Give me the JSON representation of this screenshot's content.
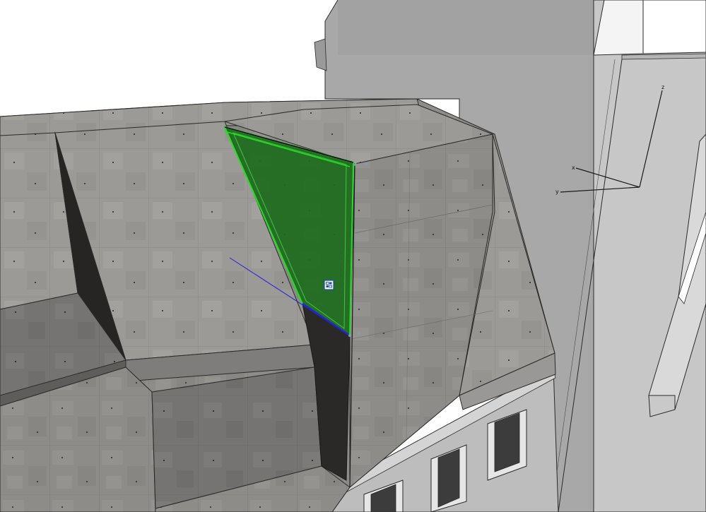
{
  "viewport": {
    "background": "#ffffff",
    "cursor_icon": "push-pull-cursor-icon"
  },
  "axes": {
    "z_label": "z",
    "x_label": "x",
    "y_label": "y",
    "axis_color": "#1a1a1a"
  },
  "materials": {
    "concrete": "#8e8c89",
    "concrete_light": "#a5a3a0",
    "concrete_dark": "#5f5d5b",
    "shadow": "#262524",
    "wall_light": "#d6d6d6",
    "wall_mid": "#c2c2c2",
    "wall_dark": "#a9a9a9",
    "selection_fill": "#1d6b1d",
    "selection_edge": "#22dd22",
    "inference_line": "#2222dd"
  }
}
